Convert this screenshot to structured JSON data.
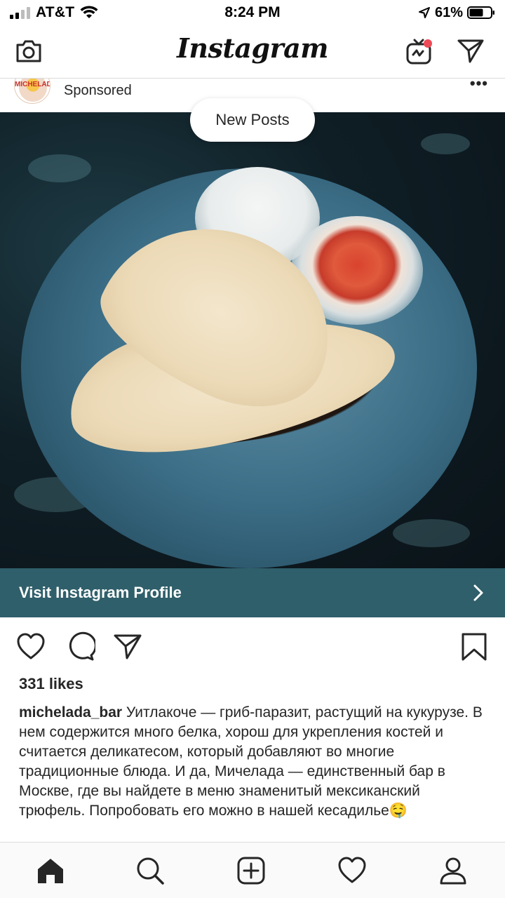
{
  "status_bar": {
    "carrier": "AT&T",
    "time": "8:24 PM",
    "battery_percent": "61%",
    "signal_bars": 2,
    "icons": [
      "signal-icon",
      "wifi-icon",
      "location-arrow-icon",
      "battery-icon"
    ]
  },
  "app_header": {
    "logo": "Instagram",
    "icons": [
      "camera-icon",
      "igtv-icon",
      "direct-message-icon"
    ],
    "notification_dot_color": "#ed4956"
  },
  "post": {
    "avatar_text": "MICHELADA",
    "sponsored_label": "Sponsored",
    "new_posts_label": "New Posts",
    "image_description_icon": "food-photo",
    "visit_profile_label": "Visit Instagram Profile",
    "visit_bar_color": "#2f5f6a",
    "likes": "331 likes",
    "username": "michelada_bar",
    "caption_text": " Уитлакоче — гриб-паразит, растущий на кукурузе. В нем содержится много белка, хорош для укрепления костей и считается деликатесом, который добавляют во многие традиционные блюда. И да, Мичелада — единственный бар в Москве, где вы найдете в меню знаменитый мексиканский трюфель. Попробовать его можно в нашей кесадилье🤤"
  },
  "actions": {
    "icons": [
      "heart-icon",
      "comment-icon",
      "share-icon",
      "bookmark-icon"
    ]
  },
  "bottom_nav": {
    "items": [
      "home-icon",
      "search-icon",
      "add-post-icon",
      "activity-heart-icon",
      "profile-icon"
    ],
    "active": "home-icon"
  }
}
